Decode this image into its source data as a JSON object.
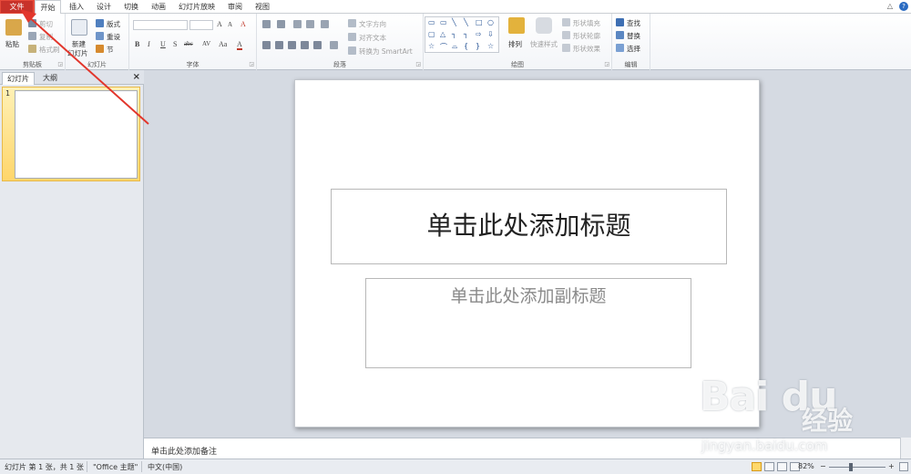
{
  "tabs": [
    "文件",
    "开始",
    "插入",
    "设计",
    "切换",
    "动画",
    "幻灯片放映",
    "审阅",
    "视图"
  ],
  "window": {
    "minimize": "△",
    "help": "?"
  },
  "ribbon": {
    "clipboard": {
      "paste": "粘贴",
      "cut": "剪切",
      "copy": "复制",
      "format_painter": "格式刷",
      "label": "剪贴板"
    },
    "slides": {
      "new_slide": "新建",
      "new_slide_2": "幻灯片",
      "layout": "版式",
      "reset": "重设",
      "section": "节",
      "label": "幻灯片"
    },
    "font": {
      "grow": "A",
      "shrink": "A",
      "bold": "B",
      "italic": "I",
      "underline": "U",
      "strike": "S",
      "shadow": "abc",
      "spacing": "AV",
      "case": "Aa",
      "color": "A",
      "clear": "A",
      "label": "字体"
    },
    "paragraph": {
      "text_direction": "文字方向",
      "align_text": "对齐文本",
      "smartart": "转换为 SmartArt",
      "label": "段落"
    },
    "drawing": {
      "arrange": "排列",
      "quick_styles": "快速样式",
      "shape_fill": "形状填充",
      "shape_outline": "形状轮廓",
      "shape_effects": "形状效果",
      "label": "绘图"
    },
    "editing": {
      "find": "查找",
      "replace": "替换",
      "select": "选择",
      "label": "编辑"
    }
  },
  "pane": {
    "tab_slides": "幻灯片",
    "tab_outline": "大纲",
    "close": "×",
    "slide_number": "1"
  },
  "slide": {
    "title_placeholder": "单击此处添加标题",
    "subtitle_placeholder": "单击此处添加副标题"
  },
  "notes": {
    "placeholder": "单击此处添加备注"
  },
  "status": {
    "slide_info": "幻灯片 第 1 张，共 1 张",
    "theme": "\"Office 主题\"",
    "language": "中文(中国)",
    "zoom": "82%",
    "zoom_minus": "−",
    "zoom_plus": "+"
  },
  "watermark": {
    "logo": "Bai du",
    "cn": "经验",
    "url": "jingyan.baidu.com"
  },
  "colors": {
    "file_tab": "#c8322a",
    "arrow": "#e2362c",
    "slide_bg": "#ffffff",
    "stage_bg": "#d5dae2"
  }
}
